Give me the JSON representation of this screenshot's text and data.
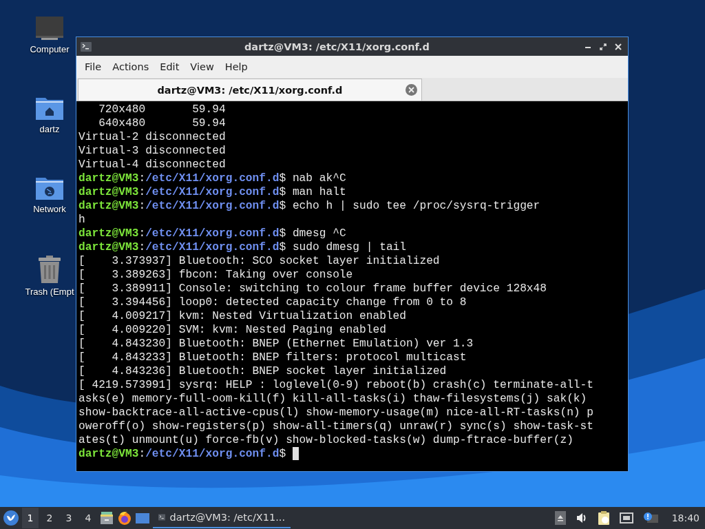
{
  "desktop_icons": [
    {
      "label": "Computer",
      "kind": "computer"
    },
    {
      "label": "dartz",
      "kind": "home"
    },
    {
      "label": "Network",
      "kind": "network"
    },
    {
      "label": "Trash (Empt",
      "kind": "trash"
    }
  ],
  "window": {
    "title": "dartz@VM3: /etc/X11/xorg.conf.d",
    "menu": [
      "File",
      "Actions",
      "Edit",
      "View",
      "Help"
    ],
    "tabs": [
      {
        "label": "dartz@VM3: /etc/X11/xorg.conf.d",
        "selected": true
      }
    ],
    "terminal": {
      "lines": [
        {
          "kind": "output",
          "text": "   720x480       59.94"
        },
        {
          "kind": "output",
          "text": "   640x480       59.94"
        },
        {
          "kind": "output",
          "text": "Virtual-2 disconnected"
        },
        {
          "kind": "output",
          "text": "Virtual-3 disconnected"
        },
        {
          "kind": "output",
          "text": "Virtual-4 disconnected"
        },
        {
          "kind": "prompt",
          "user": "dartz@VM3",
          "colon": ":",
          "path": "/etc/X11/xorg.conf.d",
          "command": "$ nab ak^C"
        },
        {
          "kind": "prompt",
          "user": "dartz@VM3",
          "colon": ":",
          "path": "/etc/X11/xorg.conf.d",
          "command": "$ man halt"
        },
        {
          "kind": "prompt",
          "user": "dartz@VM3",
          "colon": ":",
          "path": "/etc/X11/xorg.conf.d",
          "command": "$ echo h | sudo tee /proc/sysrq-trigger"
        },
        {
          "kind": "output",
          "text": "h"
        },
        {
          "kind": "prompt",
          "user": "dartz@VM3",
          "colon": ":",
          "path": "/etc/X11/xorg.conf.d",
          "command": "$ dmesg ^C"
        },
        {
          "kind": "prompt",
          "user": "dartz@VM3",
          "colon": ":",
          "path": "/etc/X11/xorg.conf.d",
          "command": "$ sudo dmesg | tail"
        },
        {
          "kind": "output",
          "text": "[    3.373937] Bluetooth: SCO socket layer initialized"
        },
        {
          "kind": "output",
          "text": "[    3.389263] fbcon: Taking over console"
        },
        {
          "kind": "output",
          "text": "[    3.389911] Console: switching to colour frame buffer device 128x48"
        },
        {
          "kind": "output",
          "text": "[    3.394456] loop0: detected capacity change from 0 to 8"
        },
        {
          "kind": "output",
          "text": "[    4.009217] kvm: Nested Virtualization enabled"
        },
        {
          "kind": "output",
          "text": "[    4.009220] SVM: kvm: Nested Paging enabled"
        },
        {
          "kind": "output",
          "text": "[    4.843230] Bluetooth: BNEP (Ethernet Emulation) ver 1.3"
        },
        {
          "kind": "output",
          "text": "[    4.843233] Bluetooth: BNEP filters: protocol multicast"
        },
        {
          "kind": "output",
          "text": "[    4.843236] Bluetooth: BNEP socket layer initialized"
        },
        {
          "kind": "output",
          "text": "[ 4219.573991] sysrq: HELP : loglevel(0-9) reboot(b) crash(c) terminate-all-t"
        },
        {
          "kind": "output",
          "text": "asks(e) memory-full-oom-kill(f) kill-all-tasks(i) thaw-filesystems(j) sak(k)"
        },
        {
          "kind": "output",
          "text": "show-backtrace-all-active-cpus(l) show-memory-usage(m) nice-all-RT-tasks(n) p"
        },
        {
          "kind": "output",
          "text": "oweroff(o) show-registers(p) show-all-timers(q) unraw(r) sync(s) show-task-st"
        },
        {
          "kind": "output",
          "text": "ates(t) unmount(u) force-fb(v) show-blocked-tasks(w) dump-ftrace-buffer(z)"
        },
        {
          "kind": "prompt",
          "user": "dartz@VM3",
          "colon": ":",
          "path": "/etc/X11/xorg.conf.d",
          "command": "$ ",
          "cursor": true
        }
      ]
    }
  },
  "taskbar": {
    "workspaces": [
      {
        "label": "1",
        "selected": true
      },
      {
        "label": "2",
        "selected": false
      },
      {
        "label": "3",
        "selected": false
      },
      {
        "label": "4",
        "selected": false
      }
    ],
    "tasks": [
      {
        "label": "dartz@VM3: /etc/X11...",
        "selected": true
      }
    ],
    "clock": "18:40"
  }
}
